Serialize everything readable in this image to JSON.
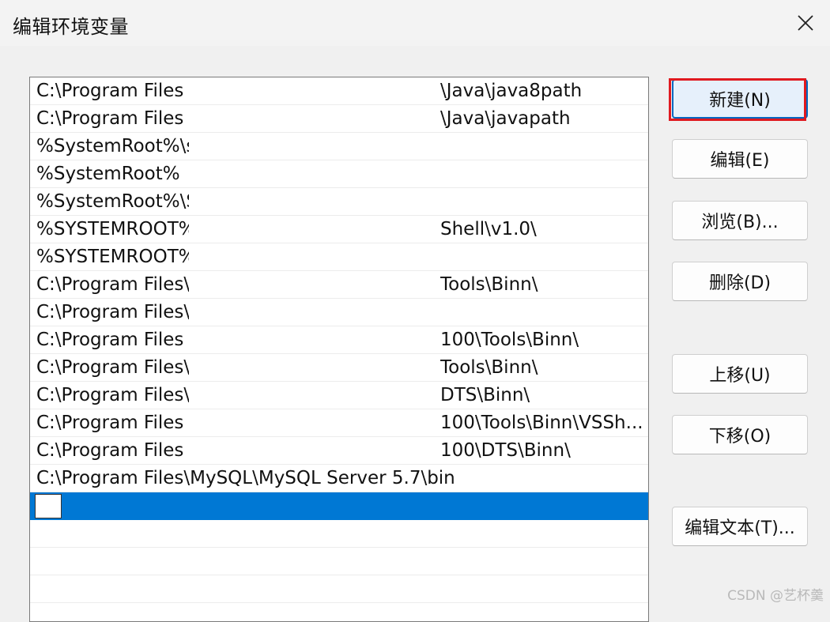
{
  "window": {
    "title": "编辑环境变量"
  },
  "list": {
    "rows": [
      {
        "left": "C:\\Program Files",
        "right": "\\Java\\java8path"
      },
      {
        "left": "C:\\Program Files",
        "right": "\\Java\\javapath"
      },
      {
        "left": "%SystemRoot%\\s",
        "right": ""
      },
      {
        "left": "%SystemRoot%",
        "right": ""
      },
      {
        "left": "%SystemRoot%\\S",
        "right": ""
      },
      {
        "left": "%SYSTEMROOT%",
        "right": "Shell\\v1.0\\"
      },
      {
        "left": "%SYSTEMROOT%",
        "right": ""
      },
      {
        "left": "C:\\Program Files\\",
        "right": "Tools\\Binn\\"
      },
      {
        "left": "C:\\Program Files\\",
        "right": ""
      },
      {
        "left": "C:\\Program Files",
        "right": "100\\Tools\\Binn\\"
      },
      {
        "left": "C:\\Program Files\\",
        "right": "Tools\\Binn\\"
      },
      {
        "left": "C:\\Program Files\\",
        "right": "DTS\\Binn\\"
      },
      {
        "left": "C:\\Program Files",
        "right": "100\\Tools\\Binn\\VSSh..."
      },
      {
        "left": "C:\\Program Files",
        "right": "100\\DTS\\Binn\\"
      },
      {
        "full": "C:\\Program Files\\MySQL\\MySQL Server 5.7\\bin"
      }
    ]
  },
  "buttons": {
    "new": "新建(N)",
    "edit": "编辑(E)",
    "browse": "浏览(B)...",
    "delete": "删除(D)",
    "move_up": "上移(U)",
    "move_down": "下移(O)",
    "edit_text": "编辑文本(T)..."
  },
  "watermark": "CSDN @艺杯羹",
  "colors": {
    "selection": "#0078d4",
    "highlight": "#e0191f",
    "primary_border": "#0067c0"
  },
  "icons": {
    "close": "close-icon"
  }
}
